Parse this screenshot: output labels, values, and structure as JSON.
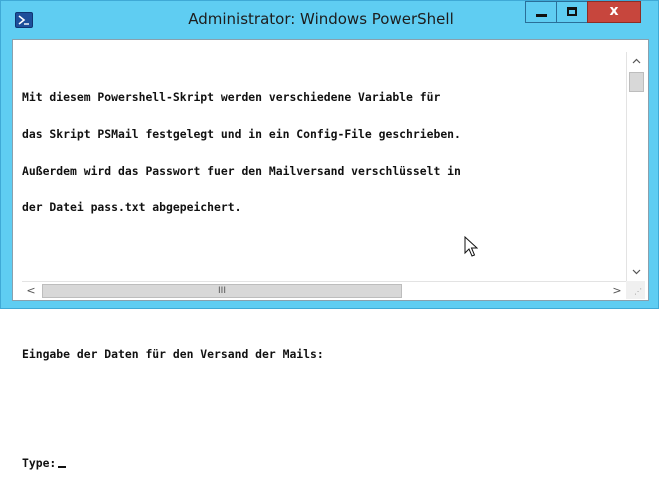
{
  "window": {
    "title": "Administrator: Windows PowerShell",
    "app_icon": "powershell-icon",
    "controls": {
      "minimize_icon": "minimize-icon",
      "maximize_icon": "maximize-icon",
      "close_label": "x"
    }
  },
  "console": {
    "lines": [
      "Mit diesem Powershell-Skript werden verschiedene Variable für",
      "das Skript PSMail festgelegt und in ein Config-File geschrieben.",
      "Außerdem wird das Passwort fuer den Mailversand verschlüsselt in",
      "der Datei pass.txt abgepeichert.",
      "Eingabe der Daten für den Versand der Mails:",
      "Type:"
    ]
  },
  "scrollbars": {
    "vertical": {
      "up_icon": "chevron-up-icon",
      "down_icon": "chevron-down-icon"
    },
    "horizontal": {
      "left_label": "<",
      "right_label": ">",
      "thumb_grip": "III"
    }
  },
  "colors": {
    "title_bar": "#5fcdf2",
    "close_button": "#c7463d",
    "console_background": "#ffffff",
    "console_text": "#111111"
  }
}
